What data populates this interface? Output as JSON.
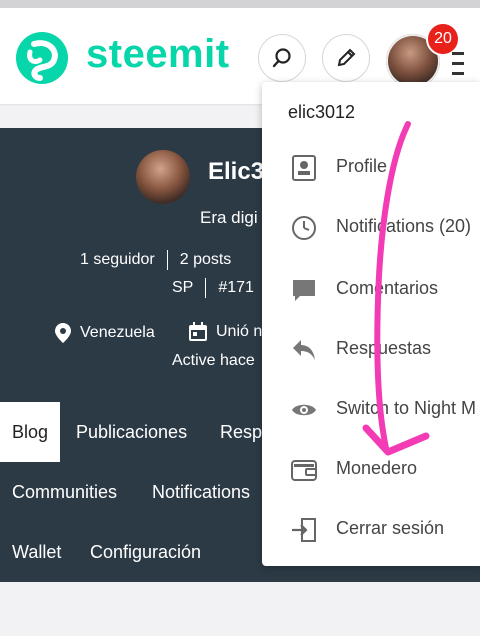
{
  "header": {
    "brand": "steemit",
    "notification_count": "20",
    "brand_color": "#06d6a9"
  },
  "profile": {
    "name": "Elic3",
    "about": "Era digi",
    "followers": "1 seguidor",
    "posts": "2 posts",
    "sp": "SP",
    "rank": "#171",
    "location": "Venezuela",
    "joined": "Unió n",
    "active": "Active hace"
  },
  "tabs": {
    "row1": [
      "Blog",
      "Publicaciones",
      "Resp"
    ],
    "row2": [
      "Communities",
      "Notifications"
    ],
    "row3": [
      "Wallet",
      "Configuración"
    ]
  },
  "menu": {
    "username": "elic3012",
    "items": [
      {
        "label": "Profile",
        "icon": "profile-icon"
      },
      {
        "label": "Notifications (20)",
        "icon": "clock-icon"
      },
      {
        "label": "Comentarios",
        "icon": "comment-icon"
      },
      {
        "label": "Respuestas",
        "icon": "reply-icon"
      },
      {
        "label": "Switch to Night M",
        "icon": "eye-icon"
      },
      {
        "label": "Monedero",
        "icon": "wallet-icon"
      },
      {
        "label": "Cerrar sesión",
        "icon": "logout-icon"
      }
    ]
  },
  "annotation_color": "#f23bb4"
}
